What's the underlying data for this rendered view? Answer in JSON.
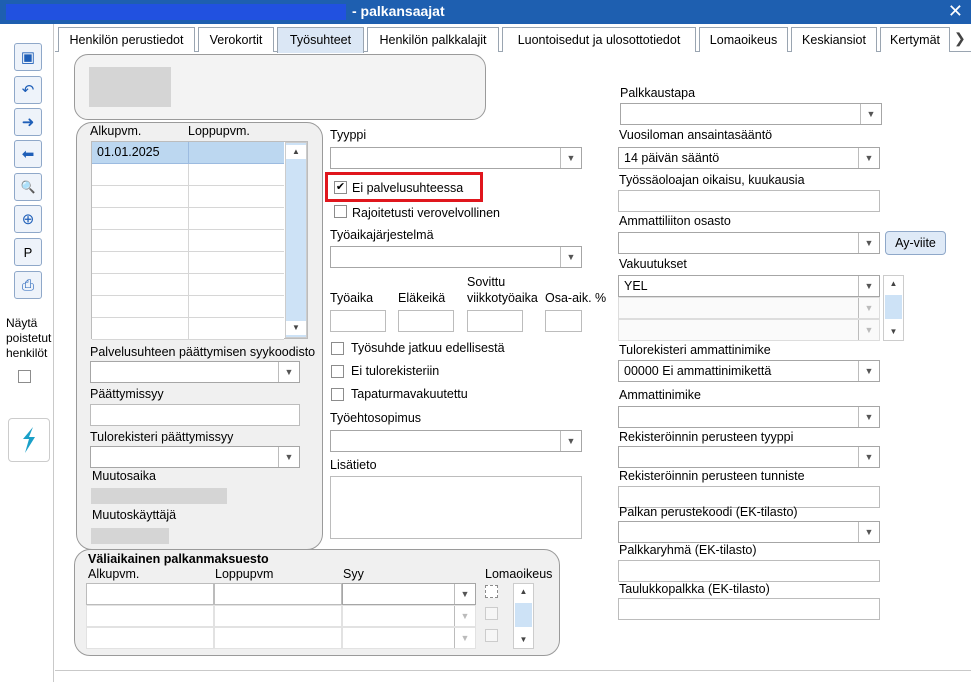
{
  "window": {
    "title": "- palkansaajat",
    "close_glyph": "✕"
  },
  "toolbar": {
    "buttons": [
      {
        "name": "save-button",
        "glyph": "▣"
      },
      {
        "name": "undo-button",
        "glyph": "↶"
      },
      {
        "name": "next-button",
        "glyph": "➜"
      },
      {
        "name": "previous-button",
        "glyph": "⬅"
      },
      {
        "name": "search-button",
        "glyph": "🔍"
      },
      {
        "name": "new-record-button",
        "glyph": "⊕"
      },
      {
        "name": "p-button",
        "glyph": "P"
      },
      {
        "name": "print-button",
        "glyph": "⎙"
      }
    ],
    "show_removed_label_1": "Näytä",
    "show_removed_label_2": "poistetut",
    "show_removed_label_3": "henkilöt",
    "app_icon": "app-logo-icon"
  },
  "tabs": [
    {
      "label": "Henkilön perustiedot",
      "active": false
    },
    {
      "label": "Verokortit",
      "active": false
    },
    {
      "label": "Työsuhteet",
      "active": true
    },
    {
      "label": "Henkilön palkkalajit",
      "active": false
    },
    {
      "label": "Luontoisedut ja ulosottotiedot",
      "active": false
    },
    {
      "label": "Lomaoikeus",
      "active": false
    },
    {
      "label": "Keskiansiot",
      "active": false
    },
    {
      "label": "Kertymät",
      "active": false
    }
  ],
  "employment_list": {
    "col_start": "Alkupvm.",
    "col_end": "Loppupvm.",
    "rows": [
      {
        "start": "01.01.2025",
        "end": ""
      }
    ]
  },
  "left_panel": {
    "termination_code_label": "Palvelusuhteen päättymisen syykoodisto",
    "termination_reason_label": "Päättymissyy",
    "income_reg_termination_label": "Tulorekisteri päättymissyy",
    "modified_at_label": "Muutosaika",
    "modified_by_label": "Muutoskäyttäjä"
  },
  "middle_panel": {
    "type_label": "Tyyppi",
    "not_employment_label": "Ei palvelusuhteessa",
    "not_employment_checked": true,
    "limited_tax_label": "Rajoitetusti verovelvollinen",
    "work_schedule_label": "Työaikajärjestelmä",
    "working_hours_label": "Työaika",
    "pension_age_label": "Eläkeikä",
    "agreed_label_1": "Sovittu",
    "agreed_label_2": "viikkotyöaika",
    "part_time_label": "Osa-aik. %",
    "continues_label": "Työsuhde jatkuu edellisestä",
    "no_income_reg_label": "Ei tulorekisteriin",
    "accident_insured_label": "Tapaturmavakuutettu",
    "collective_agreement_label": "Työehtosopimus",
    "additional_info_label": "Lisätieto"
  },
  "right_panel": {
    "payment_method_label": "Palkkaustapa",
    "vacation_rule_label": "Vuosiloman ansaintasääntö",
    "vacation_rule_value": "14 päivän sääntö",
    "employer_correction_label": "Työssäoloajan oikaisu, kuukausia",
    "union_label": "Ammattiliiton osasto",
    "union_button": "Ay-viite",
    "insurances_label": "Vakuutukset",
    "insurances_value": "YEL",
    "income_reg_title_label": "Tulorekisteri ammattinimike",
    "income_reg_title_value": "00000 Ei ammattinimikettä",
    "job_title_label": "Ammattinimike",
    "registration_type_label": "Rekisteröinnin perusteen tyyppi",
    "registration_id_label": "Rekisteröinnin perusteen tunniste",
    "salary_code_label": "Palkan perustekoodi (EK-tilasto)",
    "salary_group_label": "Palkkaryhmä (EK-tilasto)",
    "table_salary_label": "Taulukkopalkka (EK-tilasto)"
  },
  "temp_payment": {
    "title": "Väliaikainen palkanmaksuesto",
    "col_start": "Alkupvm.",
    "col_end": "Loppupvm",
    "col_reason": "Syy",
    "col_vacation": "Lomaoikeus"
  },
  "colors": {
    "highlight": "#e0161d",
    "titlebar": "#1e5fb0",
    "selected_row": "#bcd7f0"
  }
}
